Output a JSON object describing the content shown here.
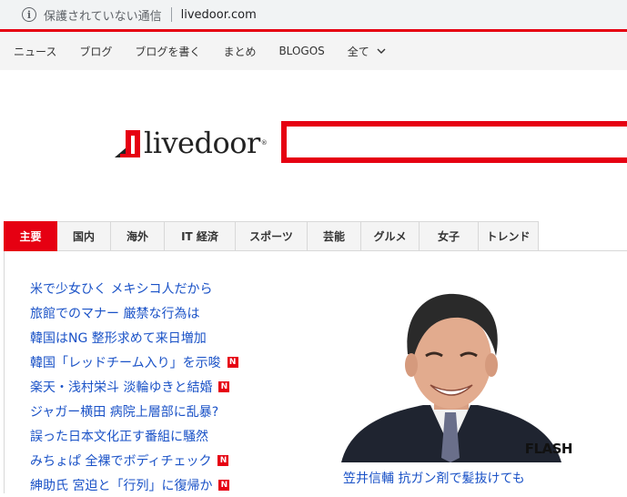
{
  "browser": {
    "security_text": "保護されていない通信",
    "url": "livedoor.com"
  },
  "topnav": [
    "ニュース",
    "ブログ",
    "ブログを書く",
    "まとめ",
    "BLOGOS",
    "全て"
  ],
  "logo": {
    "text": "livedoor",
    "mark": "®"
  },
  "tabs": [
    "主要",
    "国内",
    "海外",
    "IT 経済",
    "スポーツ",
    "芸能",
    "グルメ",
    "女子",
    "トレンド"
  ],
  "active_tab": "主要",
  "headlines": [
    {
      "text": "米で少女ひく メキシコ人だから",
      "badge": ""
    },
    {
      "text": "旅館でのマナー 厳禁な行為は",
      "badge": ""
    },
    {
      "text": "韓国はNG 整形求めて来日増加",
      "badge": ""
    },
    {
      "text": "韓国「レッドチーム入り」を示唆",
      "badge": "N"
    },
    {
      "text": "楽天・浅村栄斗 淡輪ゆきと結婚",
      "badge": "N"
    },
    {
      "text": "ジャガー横田 病院上層部に乱暴?",
      "badge": ""
    },
    {
      "text": "誤った日本文化正す番組に騒然",
      "badge": ""
    },
    {
      "text": "みちょぱ 全裸でボディチェック",
      "badge": "N"
    },
    {
      "text": "紳助氏 宮迫と「行列」に復帰か",
      "badge": "N"
    }
  ],
  "photo": {
    "watermark": "FLASH",
    "caption": "笠井信輔 抗ガン剤で髪抜けても"
  },
  "colors": {
    "brand_red": "#e60012",
    "link_blue": "#1a52c7"
  }
}
